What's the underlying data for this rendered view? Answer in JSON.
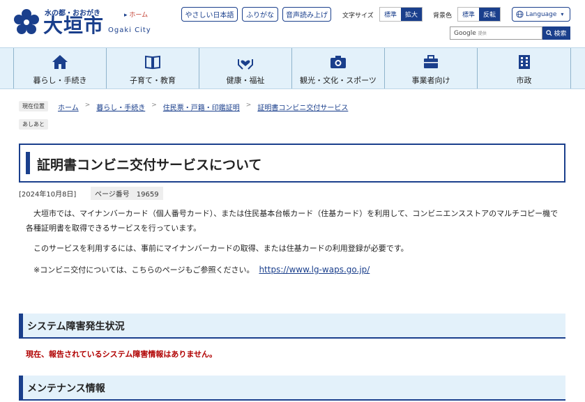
{
  "header": {
    "tagline": "水の都・おおがき",
    "city_name": "大垣市",
    "city_en": "Ogaki City",
    "home_link": "ホーム",
    "tools": {
      "easy_japanese": "やさしい日本語",
      "furigana": "ふりがな",
      "read_aloud": "音声読み上げ",
      "font_size_label": "文字サイズ",
      "font_size_options": [
        "標準",
        "拡大"
      ],
      "bg_color_label": "背景色",
      "bg_color_options": [
        "標準",
        "反転"
      ],
      "language": "Language"
    },
    "search": {
      "placeholder": "Google",
      "provided_by": "提供",
      "button": "検索"
    }
  },
  "nav": [
    {
      "label": "暮らし・手続き",
      "icon": "home-icon"
    },
    {
      "label": "子育て・教育",
      "icon": "book-icon"
    },
    {
      "label": "健康・福祉",
      "icon": "heart-hands-icon"
    },
    {
      "label": "観光・文化・スポーツ",
      "icon": "camera-icon"
    },
    {
      "label": "事業者向け",
      "icon": "briefcase-icon"
    },
    {
      "label": "市政",
      "icon": "building-icon"
    }
  ],
  "breadcrumb": {
    "current_label": "現在位置",
    "footprint_label": "あしあと",
    "items": [
      "ホーム",
      "暮らし・手続き",
      "住民票・戸籍・印鑑証明",
      "証明書コンビニ交付サービス"
    ]
  },
  "page": {
    "title": "証明書コンビニ交付サービスについて",
    "date": "[2024年10月8日]",
    "page_number": "ページ番号　19659",
    "paragraphs": [
      "大垣市では、マイナンバーカード（個人番号カード）、または住民基本台帳カード（住基カード）を利用して、コンビニエンスストアのマルチコピー機で各種証明書を取得できるサービスを行っています。",
      "このサービスを利用するには、事前にマイナンバーカードの取得、または住基カードの利用登録が必要です。",
      "※コンビニ交付については、こちらのページもご参照ください。"
    ],
    "link": "https://www.lg-waps.go.jp/"
  },
  "sections": {
    "system_status": {
      "heading": "システム障害発生状況",
      "message": "現在、報告されているシステム障害情報はありません。"
    },
    "maintenance": {
      "heading": "メンテナンス情報"
    }
  },
  "colors": {
    "primary": "#1a3f8c",
    "nav_bg": "#e3f1fa",
    "alert": "#b00000"
  }
}
